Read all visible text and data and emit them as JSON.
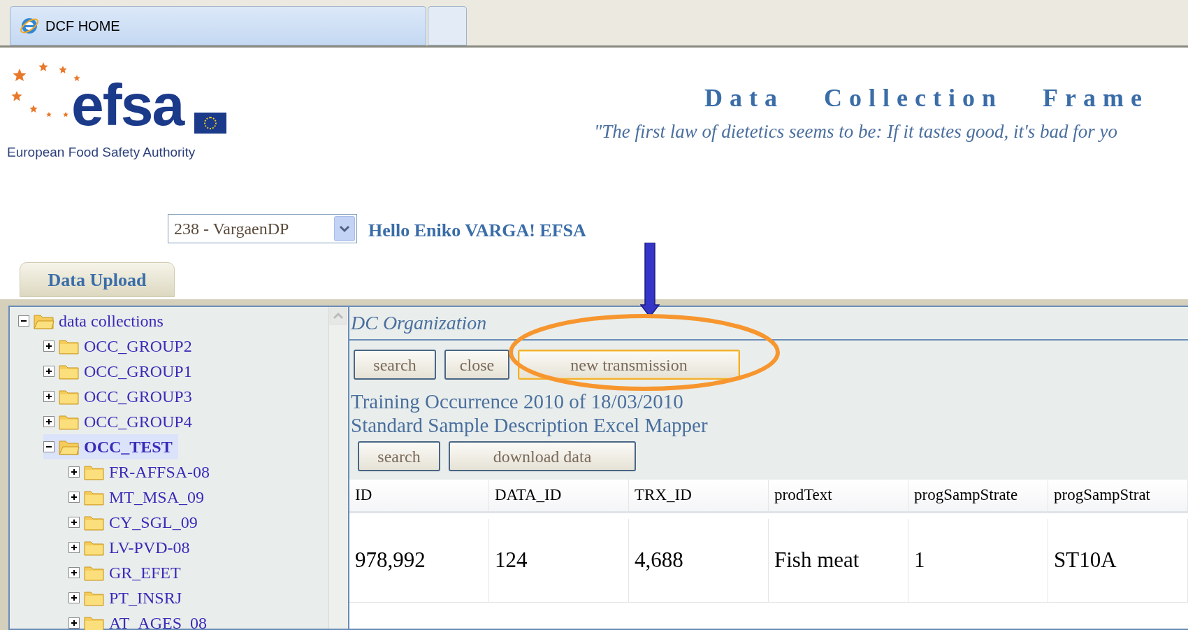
{
  "browser_tabs": [
    {
      "title": "DCF HOME",
      "selected": true
    },
    {
      "selected": false
    }
  ],
  "header": {
    "logo_text": "efsa",
    "logo_subtitle": "European Food Safety Authority",
    "title": "Data   Collection   Frame",
    "quote": "\"The first law of dietetics seems to be: If it tastes good, it's bad for yo"
  },
  "account_select": {
    "value": "238 - VargaenDP"
  },
  "greeting": "Hello Eniko VARGA! EFSA",
  "main_tabs": [
    {
      "label": "Data Upload",
      "selected": true
    }
  ],
  "tree": [
    {
      "label": "data collections",
      "expanded": true,
      "selected": false,
      "children": [
        {
          "label": "OCC_GROUP2",
          "expanded": false,
          "selected": false
        },
        {
          "label": "OCC_GROUP1",
          "expanded": false,
          "selected": false
        },
        {
          "label": "OCC_GROUP3",
          "expanded": false,
          "selected": false
        },
        {
          "label": "OCC_GROUP4",
          "expanded": false,
          "selected": false
        },
        {
          "label": "OCC_TEST",
          "expanded": true,
          "selected": true,
          "children": [
            {
              "label": "FR-AFFSA-08",
              "expanded": false,
              "selected": false
            },
            {
              "label": "MT_MSA_09",
              "expanded": false,
              "selected": false
            },
            {
              "label": "CY_SGL_09",
              "expanded": false,
              "selected": false
            },
            {
              "label": "LV-PVD-08",
              "expanded": false,
              "selected": false
            },
            {
              "label": "GR_EFET",
              "expanded": false,
              "selected": false
            },
            {
              "label": "PT_INSRJ",
              "expanded": false,
              "selected": false
            },
            {
              "label": "AT_AGES_08",
              "expanded": false,
              "selected": false
            }
          ]
        }
      ]
    }
  ],
  "panel": {
    "title": "DC Organization",
    "buttons": [
      {
        "label": "search",
        "highlighted": false
      },
      {
        "label": "close",
        "highlighted": false
      },
      {
        "label": "new transmission",
        "highlighted": true
      }
    ],
    "info_lines": [
      "Training Occurrence 2010 of 18/03/2010",
      "Standard Sample Description Excel Mapper"
    ],
    "buttons_2": [
      {
        "label": "search"
      },
      {
        "label": "download data"
      }
    ],
    "table": {
      "columns": [
        "ID",
        "DATA_ID",
        "TRX_ID",
        "prodText",
        "progSampStrate",
        "progSampStrat"
      ],
      "rows": [
        [
          "978,992",
          "124",
          "4,688",
          "Fish meat",
          "1",
          "ST10A"
        ]
      ]
    }
  }
}
